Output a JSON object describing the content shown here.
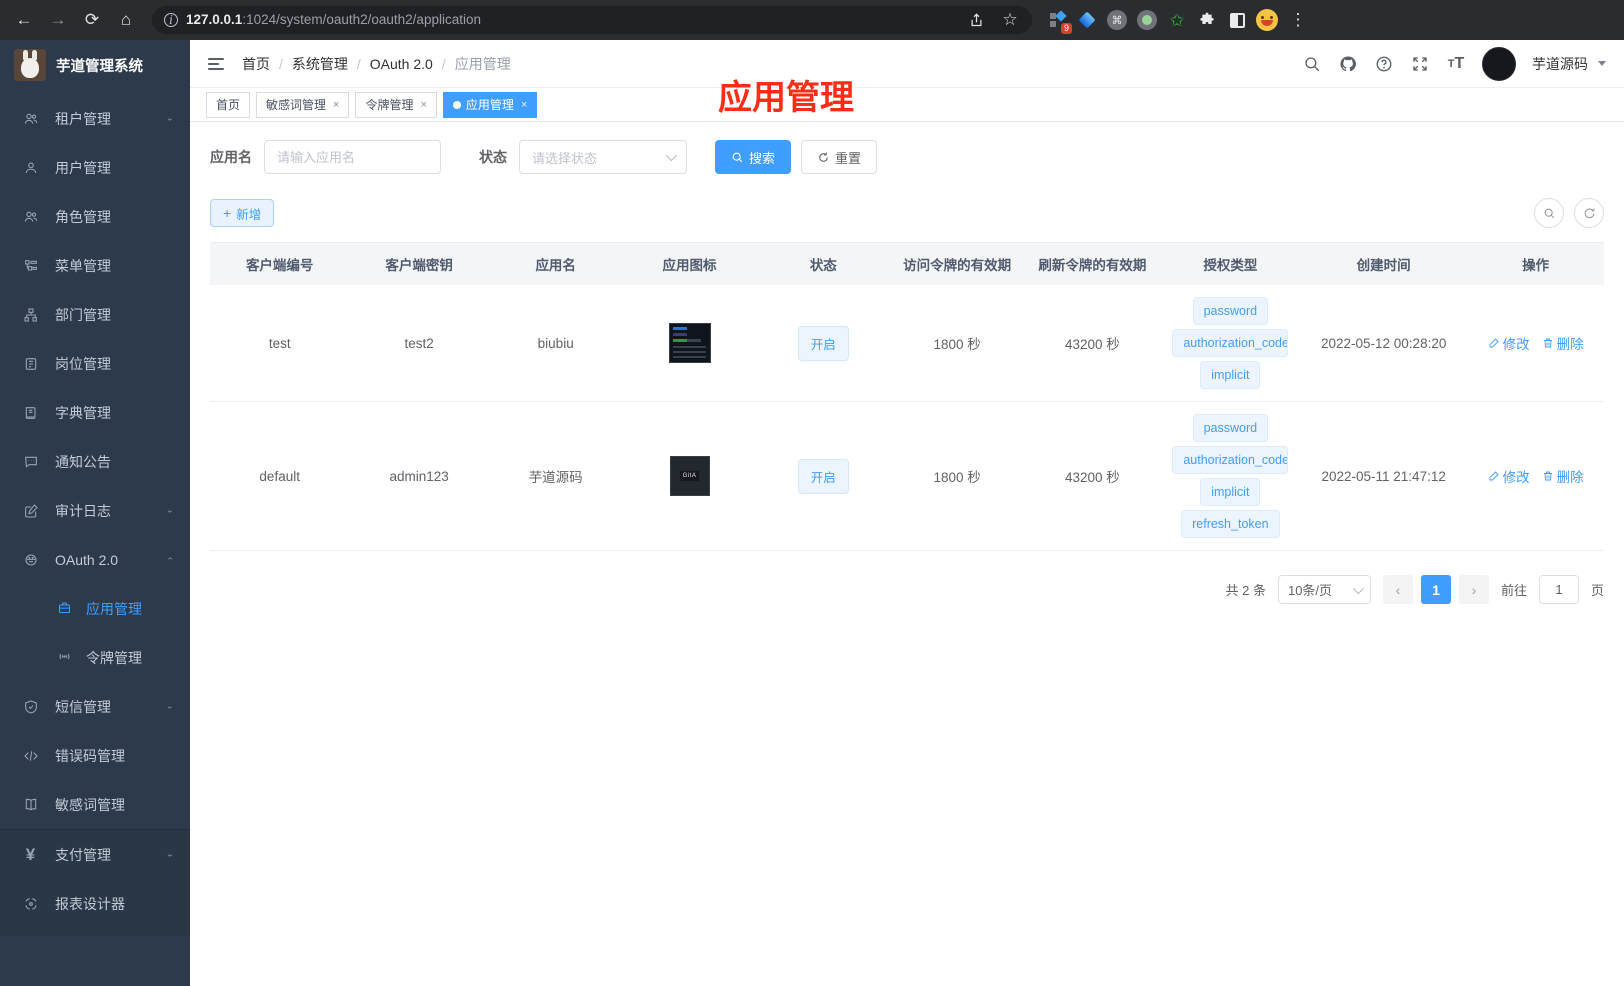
{
  "browser": {
    "url_host": "127.0.0.1",
    "url_path": ":1024/system/oauth2/oauth2/application",
    "extension_badge": "9"
  },
  "sidebar": {
    "title": "芋道管理系统",
    "items": [
      {
        "label": "租户管理"
      },
      {
        "label": "用户管理"
      },
      {
        "label": "角色管理"
      },
      {
        "label": "菜单管理"
      },
      {
        "label": "部门管理"
      },
      {
        "label": "岗位管理"
      },
      {
        "label": "字典管理"
      },
      {
        "label": "通知公告"
      },
      {
        "label": "审计日志"
      },
      {
        "label": "OAuth 2.0"
      },
      {
        "label": "应用管理"
      },
      {
        "label": "令牌管理"
      },
      {
        "label": "短信管理"
      },
      {
        "label": "错误码管理"
      },
      {
        "label": "敏感词管理"
      },
      {
        "label": "支付管理"
      },
      {
        "label": "报表设计器"
      }
    ]
  },
  "navbar": {
    "breadcrumb": [
      "首页",
      "系统管理",
      "OAuth 2.0",
      "应用管理"
    ],
    "username": "芋道源码"
  },
  "annotation": "应用管理",
  "tabs": [
    {
      "label": "首页"
    },
    {
      "label": "敏感词管理"
    },
    {
      "label": "令牌管理"
    },
    {
      "label": "应用管理"
    }
  ],
  "filters": {
    "name_label": "应用名",
    "name_placeholder": "请输入应用名",
    "status_label": "状态",
    "status_placeholder": "请选择状态",
    "search_label": "搜索",
    "reset_label": "重置",
    "add_label": "新增"
  },
  "table": {
    "headers": [
      "客户端编号",
      "客户端密钥",
      "应用名",
      "应用图标",
      "状态",
      "访问令牌的有效期",
      "刷新令牌的有效期",
      "授权类型",
      "创建时间",
      "操作"
    ],
    "edit_label": "修改",
    "delete_label": "删除",
    "rows": [
      {
        "client_id": "test",
        "secret": "test2",
        "name": "biubiu",
        "status": "开启",
        "access_validity": "1800 秒",
        "refresh_validity": "43200 秒",
        "grants": [
          "password",
          "authorization_code",
          "implicit"
        ],
        "created": "2022-05-12 00:28:20"
      },
      {
        "client_id": "default",
        "secret": "admin123",
        "name": "芋道源码",
        "status": "开启",
        "access_validity": "1800 秒",
        "refresh_validity": "43200 秒",
        "grants": [
          "password",
          "authorization_code",
          "implicit",
          "refresh_token"
        ],
        "created": "2022-05-11 21:47:12"
      }
    ]
  },
  "pagination": {
    "total": "共 2 条",
    "per_page": "10条/页",
    "prev": "‹",
    "current_page": "1",
    "next": "›",
    "goto_prefix": "前往",
    "goto_value": "1",
    "goto_suffix": "页"
  },
  "colors": {
    "primary": "#409eff",
    "annotation_red": "#fb2d17",
    "sidebar_bg": "#2d3a4b"
  }
}
